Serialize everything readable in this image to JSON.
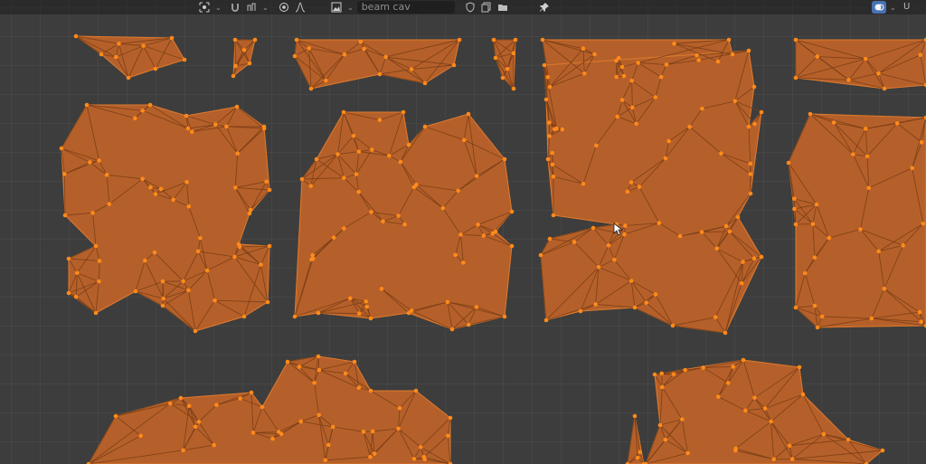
{
  "header": {
    "mesh_name": "beam cav",
    "right_label": "U"
  },
  "colors": {
    "viewport_bg": "#3d3d3d",
    "island_fill": "#b5602a",
    "island_outline": "#e07a2c",
    "edge": "#7a3d15",
    "vertex": "#ff8a1a",
    "header_bg": "#2b2b2b",
    "active_button": "#4772b3"
  },
  "icons": [
    "pivot-icon",
    "snap-magnet-icon",
    "proportional-edit-icon",
    "falloff-curve-icon",
    "image-browse-icon",
    "fake-user-shield-icon",
    "new-image-icon",
    "open-image-icon",
    "pin-icon",
    "overlay-icon"
  ]
}
